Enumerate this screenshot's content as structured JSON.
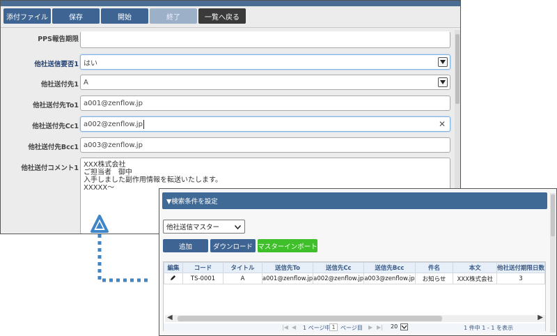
{
  "toolbar": {
    "attach_label": "添付ファイル",
    "save_label": "保存",
    "start_label": "開始",
    "end_label": "終了",
    "back_label": "一覧へ戻る"
  },
  "form": {
    "cut_label": "PPS報告期限",
    "needed_label": "他社送信要否1",
    "needed_value": "はい",
    "dest_label": "他社送付先1",
    "dest_value": "A",
    "to_label": "他社送付先To1",
    "to_value": "a001@zenflow.jp",
    "cc_label": "他社送付先Cc1",
    "cc_value": "a002@zenflow.jp",
    "bcc_label": "他社送付先Bcc1",
    "bcc_value": "a003@zenflow.jp",
    "comment_label": "他社送付コメント1",
    "comment_lines": [
      "XXX株式会社",
      "ご担当者　御中",
      "",
      "入手しました副作用情報を転送いたします。",
      "",
      "XXXXX～"
    ]
  },
  "search": {
    "header": "▼検索条件を設定",
    "master_select": "他社送信マスター",
    "add_label": "追加",
    "download_label": "ダウンロード",
    "import_label": "マスターインポート",
    "columns": [
      "編集",
      "コード",
      "タイトル",
      "送信先To",
      "送信先Cc",
      "送信先Bcc",
      "件名",
      "本文",
      "他社送付期限日数"
    ],
    "row": [
      "",
      "TS-0001",
      "A",
      "a001@zenflow.jp",
      "a002@zenflow.jp",
      "a003@zenflow.jp",
      "お知らせ",
      "XXX株式会社 ",
      "3"
    ],
    "pager_prefix": "1 ページ中",
    "page_number": "1",
    "pager_suffix": "ページ目",
    "page_size": "20",
    "count_text": "1 件中 1 - 1 を表示"
  },
  "colors": {
    "toolbar_blue": "#3d6492",
    "header_blue": "#3f6a96",
    "import_green": "#3fbf2a",
    "marker_blue": "#3f86c9"
  }
}
